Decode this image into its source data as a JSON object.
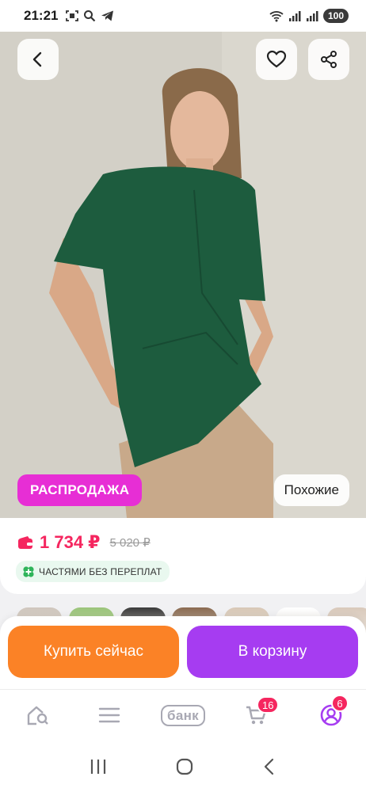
{
  "status_bar": {
    "time": "21:21",
    "battery": "100",
    "left_icons": [
      "screenshot-icon",
      "search-icon",
      "telegram-icon"
    ],
    "right_icons": [
      "wifi-icon",
      "signal-icon",
      "signal-icon"
    ]
  },
  "hero": {
    "sale_badge": "РАСПРОДАЖА",
    "similar_button": "Похожие"
  },
  "price": {
    "current": "1 734 ₽",
    "old": "5 020 ₽",
    "wallet_icon": "wallet-icon",
    "installments_label": "ЧАСТЯМИ БЕЗ ПЕРЕПЛАТ"
  },
  "actions": {
    "buy_now": "Купить сейчас",
    "add_to_cart": "В корзину"
  },
  "bottom_nav": {
    "bank_label": "банк",
    "cart_badge": "16",
    "profile_badge": "6"
  },
  "colors": {
    "accent_pink": "#f5265f",
    "sale_magenta": "#e72ed5",
    "buy_orange": "#fb8226",
    "cart_purple": "#a63cf1",
    "installments_green": "#2fb45a"
  }
}
